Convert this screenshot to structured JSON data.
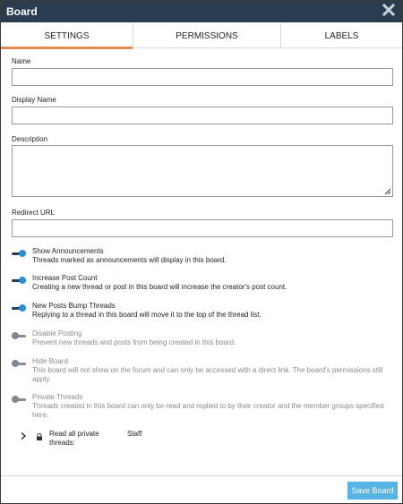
{
  "dialog": {
    "title": "Board"
  },
  "tabs": [
    {
      "label": "SETTINGS",
      "active": true
    },
    {
      "label": "PERMISSIONS",
      "active": false
    },
    {
      "label": "LABELS",
      "active": false
    }
  ],
  "fields": {
    "name": {
      "label": "Name",
      "value": ""
    },
    "display_name": {
      "label": "Display Name",
      "value": ""
    },
    "description": {
      "label": "Description",
      "value": ""
    },
    "redirect_url": {
      "label": "Redirect URL",
      "value": ""
    }
  },
  "toggles": [
    {
      "title": "Show Announcements",
      "desc": "Threads marked as announcements will display in this board.",
      "on": true,
      "enabled": true
    },
    {
      "title": "Increase Post Count",
      "desc": "Creating a new thread or post in this board will increase the creator's post count.",
      "on": true,
      "enabled": true
    },
    {
      "title": "New Posts Bump Threads",
      "desc": "Replying to a thread in this board will move it to the top of the thread list.",
      "on": true,
      "enabled": true
    },
    {
      "title": "Disable Posting",
      "desc": "Prevent new threads and posts from being created in this board.",
      "on": false,
      "enabled": false
    },
    {
      "title": "Hide Board",
      "desc": "This board will not show on the forum and can only be accessed with a direct link. The board's permissions still apply.",
      "on": false,
      "enabled": false
    },
    {
      "title": "Private Threads",
      "desc": "Threads created in this board can only be read and replied to by their creator and the member groups specified here.",
      "on": false,
      "enabled": false
    }
  ],
  "private_permission": {
    "label": "Read all private threads:",
    "value": "Staff"
  },
  "footer": {
    "save_label": "Save Board"
  },
  "colors": {
    "titlebar": "#2a3c4f",
    "tab_accent": "#e58a4e",
    "toggle_on": "#2b8fd8",
    "save_button": "#56b4e3"
  }
}
